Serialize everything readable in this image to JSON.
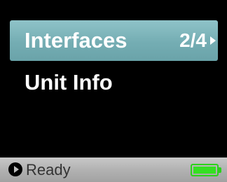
{
  "menu": {
    "items": [
      {
        "label": "Interfaces",
        "page_indicator": "2/4",
        "selected": true
      },
      {
        "label": "Unit Info",
        "selected": false
      }
    ]
  },
  "status_bar": {
    "status_icon": "play-circle-icon",
    "status_text": "Ready",
    "battery_icon": "battery-icon",
    "battery_level": 1.0,
    "battery_color": "#35e022"
  },
  "colors": {
    "background": "#000000",
    "selection": "#7ab3b9",
    "text": "#ffffff"
  }
}
